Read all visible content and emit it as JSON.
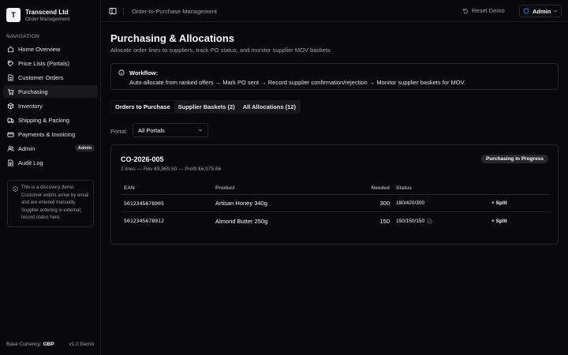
{
  "brand": {
    "logo_letter": "T",
    "name": "Transcend Ltd",
    "subtitle": "Order Management"
  },
  "sidebar": {
    "heading": "NAVIGATION",
    "items": [
      {
        "label": "Home Overview",
        "icon": "home-icon"
      },
      {
        "label": "Price Lists (Portals)",
        "icon": "tag-icon"
      },
      {
        "label": "Customer Orders",
        "icon": "file-icon"
      },
      {
        "label": "Purchasing",
        "icon": "cart-icon",
        "active": true
      },
      {
        "label": "Inventory",
        "icon": "box-icon"
      },
      {
        "label": "Shipping & Packing",
        "icon": "truck-icon"
      },
      {
        "label": "Payments & Invoicing",
        "icon": "card-icon"
      },
      {
        "label": "Admin",
        "icon": "users-icon",
        "badge": "Admin"
      },
      {
        "label": "Audit Log",
        "icon": "log-icon"
      }
    ],
    "info": "This is a discovery demo. Customer orders arrive by email and are entered manually. Supplier ordering is external; record status here.",
    "footer": {
      "currency_label": "Base Currency:",
      "currency": "GBP",
      "version": "v1.0 Demo"
    }
  },
  "topbar": {
    "title": "Order-to-Purchase Management",
    "reset_label": "Reset Demo",
    "user_label": "Admin"
  },
  "main": {
    "title": "Purchasing & Allocations",
    "subtitle": "Allocate order lines to suppliers, track PO status, and monitor supplier MOV baskets",
    "workflow_title": "Workflow:",
    "workflow_text": "Auto-allocate from ranked offers → Mark PO sent → Record supplier confirmation/rejection → Monitor supplier baskets for MOV.",
    "tabs": [
      {
        "label": "Orders to Purchase",
        "active": true
      },
      {
        "label": "Supplier Baskets (2)"
      },
      {
        "label": "All Allocations (12)"
      }
    ],
    "portal_label": "Portal:",
    "portal_value": "All Portals",
    "order": {
      "id": "CO-2026-005",
      "meta": "2 lines — Rev £9,869.50 — Profit £6,975.66",
      "status": "Purchasing in Progress",
      "columns": {
        "ean": "EAN",
        "product": "Product",
        "needed": "Needed",
        "status": "Status"
      },
      "rows": [
        {
          "ean": "5012345678905",
          "product": "Artisan Honey 340g",
          "needed": "300",
          "status": "180/420/300",
          "split": "+ Split",
          "check": false
        },
        {
          "ean": "5012345678912",
          "product": "Almond Butter 250g",
          "needed": "150",
          "status": "150/150/150",
          "split": "+ Split",
          "check": true
        }
      ]
    }
  },
  "colors": {
    "background": "#09090b",
    "border": "#27272a",
    "muted": "#a1a1aa",
    "accent": "#3b82f6"
  }
}
